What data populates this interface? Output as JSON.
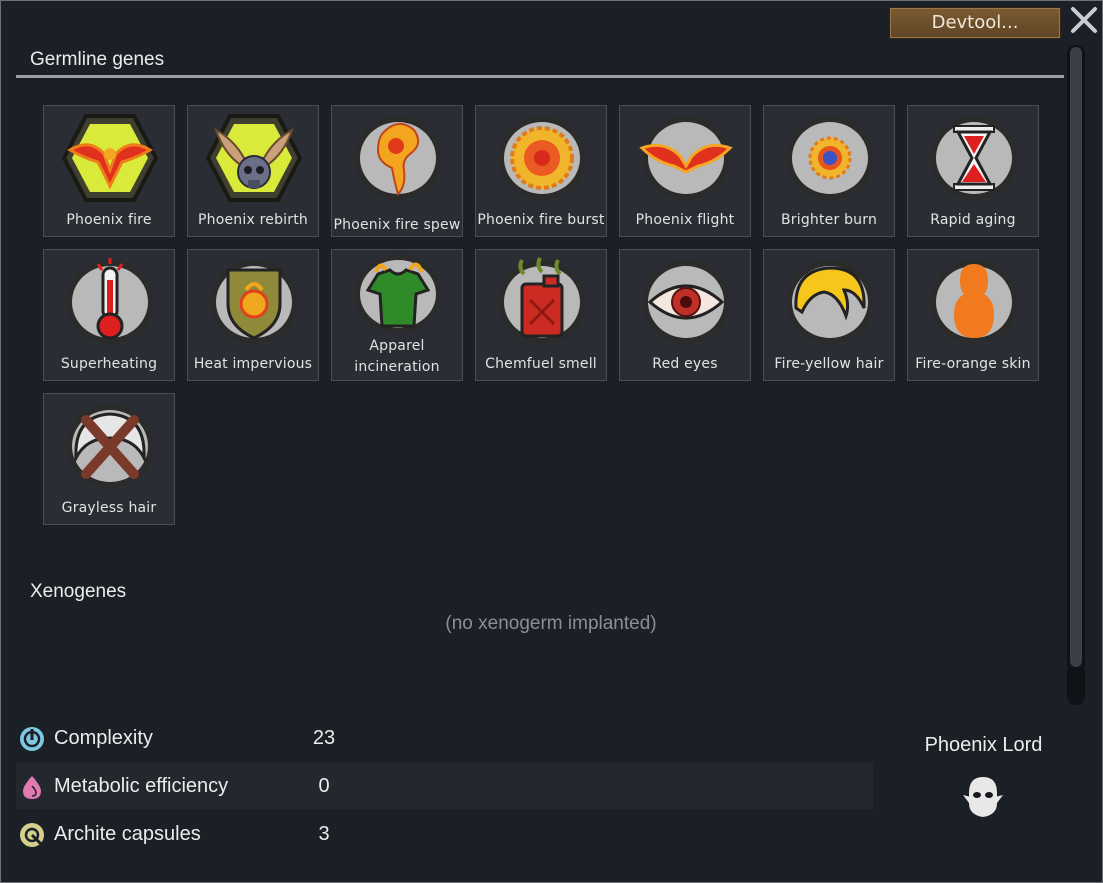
{
  "header": {
    "devtool_label": "Devtool..."
  },
  "germline": {
    "title": "Germline genes",
    "genes": [
      {
        "label": "Phoenix fire",
        "icon": "phoenix-fire-icon"
      },
      {
        "label": "Phoenix rebirth",
        "icon": "phoenix-rebirth-icon"
      },
      {
        "label": "Phoenix fire spew",
        "icon": "fire-spew-icon"
      },
      {
        "label": "Phoenix fire burst",
        "icon": "fire-burst-icon"
      },
      {
        "label": "Phoenix flight",
        "icon": "phoenix-flight-icon"
      },
      {
        "label": "Brighter burn",
        "icon": "brighter-burn-icon"
      },
      {
        "label": "Rapid aging",
        "icon": "hourglass-icon"
      },
      {
        "label": "Superheating",
        "icon": "thermometer-icon"
      },
      {
        "label": "Heat impervious",
        "icon": "heat-shield-icon"
      },
      {
        "label": "Apparel incineration",
        "icon": "burning-shirt-icon"
      },
      {
        "label": "Chemfuel smell",
        "icon": "fuel-can-icon"
      },
      {
        "label": "Red eyes",
        "icon": "red-eye-icon"
      },
      {
        "label": "Fire-yellow hair",
        "icon": "yellow-hair-icon"
      },
      {
        "label": "Fire-orange skin",
        "icon": "orange-skin-icon"
      },
      {
        "label": "Grayless hair",
        "icon": "grayless-hair-icon"
      }
    ]
  },
  "xenogenes": {
    "title": "Xenogenes",
    "empty_text": "(no xenogerm implanted)"
  },
  "stats": [
    {
      "name": "Complexity",
      "value": "23",
      "icon": "complexity-icon",
      "color": "#7ec8e3"
    },
    {
      "name": "Metabolic efficiency",
      "value": "0",
      "icon": "metabolism-icon",
      "color": "#e07ab0"
    },
    {
      "name": "Archite capsules",
      "value": "3",
      "icon": "archite-icon",
      "color": "#d4d08a"
    }
  ],
  "xenotype": {
    "name": "Phoenix Lord",
    "icon": "xenotype-icon"
  }
}
